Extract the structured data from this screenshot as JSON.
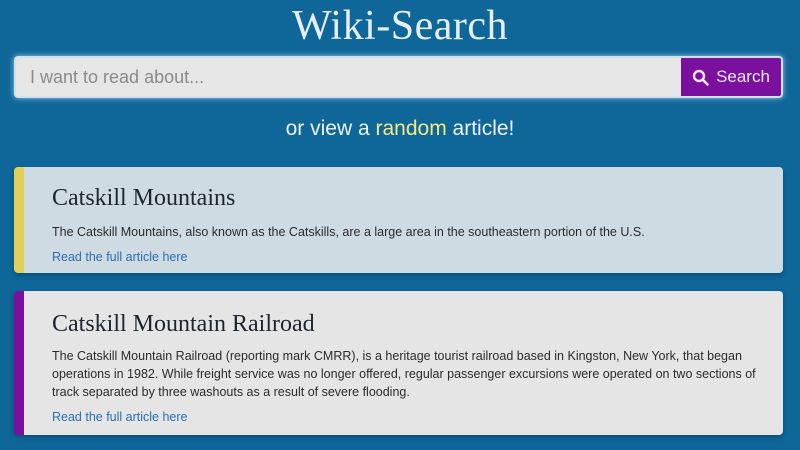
{
  "app": {
    "title": "Wiki-Search"
  },
  "search": {
    "placeholder": "I want to read about...",
    "value": "",
    "button_label": "Search"
  },
  "random": {
    "prefix": "or view a ",
    "link_label": "random",
    "suffix": " article!"
  },
  "results": [
    {
      "title": "Catskill Mountains",
      "summary": "The Catskill Mountains, also known as the Catskills, are a large area in the southeastern portion of the U.S.",
      "link_label": "Read the full article here",
      "accent_color": "#e2cf5a"
    },
    {
      "title": "Catskill Mountain Railroad",
      "summary": "The Catskill Mountain Railroad (reporting mark CMRR), is a heritage tourist railroad based in Kingston, New York, that began operations in 1982. While freight service was no longer offered, regular passenger excursions were operated on two sections of track separated by three washouts as a result of severe flooding.",
      "link_label": "Read the full article here",
      "accent_color": "#7b0f9e"
    }
  ],
  "colors": {
    "background": "#0e6699",
    "search_button": "#7b0f9e",
    "random_link": "#f3ea86"
  },
  "icons": {
    "search_button_icon": "search-icon"
  }
}
